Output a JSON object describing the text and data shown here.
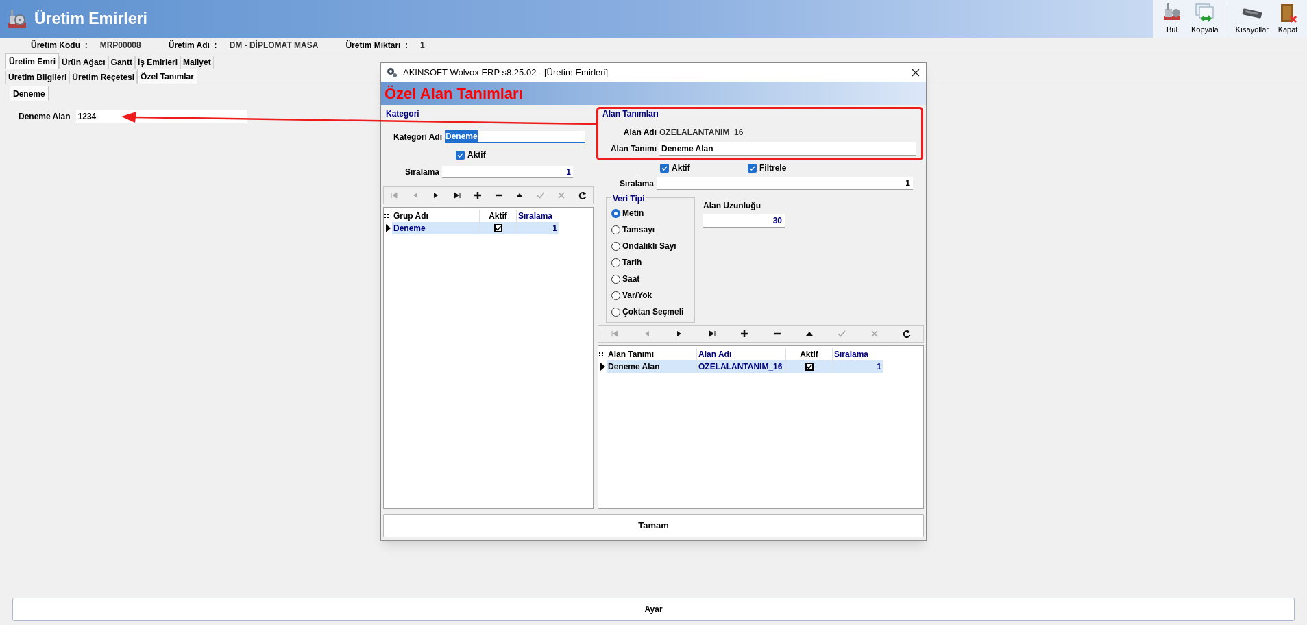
{
  "window": {
    "title": "Üretim Emirleri"
  },
  "toolbar": [
    {
      "label": "Bul",
      "kind": "factory"
    },
    {
      "label": "Kopyala",
      "kind": "copy"
    },
    {
      "label": "Kısayollar",
      "kind": "keyboard"
    },
    {
      "label": "Kapat",
      "kind": "door"
    }
  ],
  "info": [
    {
      "label": "Üretim Kodu  :",
      "value": "MRP00008"
    },
    {
      "label": "Üretim Adı  :",
      "value": "DM - DİPLOMAT MASA"
    },
    {
      "label": "Üretim Miktarı  :",
      "value": "1"
    }
  ],
  "main_tabs": [
    {
      "label": "Üretim Emri",
      "selected": true
    },
    {
      "label": "Ürün Ağacı",
      "selected": false
    },
    {
      "label": "Gantt",
      "selected": false
    },
    {
      "label": "İş Emirleri",
      "selected": false
    },
    {
      "label": "Maliyet",
      "selected": false
    }
  ],
  "sub_tabs": [
    {
      "label": "Üretim Bilgileri",
      "selected": false
    },
    {
      "label": "Üretim Reçetesi",
      "selected": false
    },
    {
      "label": "Özel Tanımlar",
      "selected": true
    }
  ],
  "category_tabs": [
    {
      "label": "Deneme",
      "selected": true
    }
  ],
  "custom_fields": [
    {
      "label": "Deneme Alan",
      "value": "1234"
    }
  ],
  "dialog": {
    "title": "AKINSOFT Wolvox ERP s8.25.02 - [Üretim Emirleri]",
    "heading": "Özel Alan Tanımları",
    "category": {
      "legend": "Kategori",
      "name_label": "Kategori Adı",
      "name_value": "Deneme",
      "name_highlighted": true,
      "active_label": "Aktif",
      "active_checked": true,
      "order_label": "Sıralama",
      "order_value": "1",
      "nav_buttons": [
        {
          "kind": "first",
          "disabled": true
        },
        {
          "kind": "prev",
          "disabled": true
        },
        {
          "kind": "next",
          "disabled": false
        },
        {
          "kind": "last",
          "disabled": false
        },
        {
          "kind": "add",
          "disabled": false
        },
        {
          "kind": "delete",
          "disabled": false
        },
        {
          "kind": "up",
          "disabled": false
        },
        {
          "kind": "confirm",
          "disabled": true
        },
        {
          "kind": "cancel",
          "disabled": true
        },
        {
          "kind": "refresh",
          "disabled": false
        }
      ],
      "grid": {
        "columns": [
          {
            "label": "Grup Adı",
            "color": "#000000"
          },
          {
            "label": "Aktif",
            "color": "#000000"
          },
          {
            "label": "Sıralama",
            "color": "#000080"
          }
        ],
        "rows": [
          {
            "name": "Deneme",
            "active": true,
            "order": "1",
            "selected": true
          }
        ]
      }
    },
    "fields": {
      "legend": "Alan Tanımları",
      "name_label": "Alan Adı",
      "name_value": "OZELALANTANIM_16",
      "definition_label": "Alan Tanımı",
      "definition_value": "Deneme Alan",
      "checks": [
        {
          "label": "Aktif",
          "checked": true
        },
        {
          "label": "Filtrele",
          "checked": true
        }
      ],
      "order_label": "Sıralama",
      "order_value": "1",
      "data_type": {
        "legend": "Veri Tipi",
        "options": [
          {
            "label": "Metin",
            "selected": true
          },
          {
            "label": "Tamsayı",
            "selected": false
          },
          {
            "label": "Ondalıklı Sayı",
            "selected": false
          },
          {
            "label": "Tarih",
            "selected": false
          },
          {
            "label": "Saat",
            "selected": false
          },
          {
            "label": "Var/Yok",
            "selected": false
          },
          {
            "label": "Çoktan Seçmeli",
            "selected": false
          }
        ]
      },
      "length_label": "Alan Uzunluğu",
      "length_value": "30",
      "nav_buttons": [
        {
          "kind": "first",
          "disabled": true
        },
        {
          "kind": "prev",
          "disabled": true
        },
        {
          "kind": "next",
          "disabled": false
        },
        {
          "kind": "last",
          "disabled": false
        },
        {
          "kind": "add",
          "disabled": false
        },
        {
          "kind": "delete",
          "disabled": false
        },
        {
          "kind": "up",
          "disabled": false
        },
        {
          "kind": "confirm",
          "disabled": true
        },
        {
          "kind": "cancel",
          "disabled": true
        },
        {
          "kind": "refresh",
          "disabled": false
        }
      ],
      "grid": {
        "columns": [
          {
            "label": "Alan Tanımı",
            "color": "#000000"
          },
          {
            "label": "Alan Adı",
            "color": "#000080"
          },
          {
            "label": "Aktif",
            "color": "#000000"
          },
          {
            "label": "Sıralama",
            "color": "#000080"
          }
        ],
        "rows": [
          {
            "definition": "Deneme Alan",
            "name": "OZELALANTANIM_16",
            "active": true,
            "order": "1",
            "selected": true
          }
        ]
      }
    },
    "ok_button": "Tamam"
  },
  "bottom_button": "Ayar"
}
